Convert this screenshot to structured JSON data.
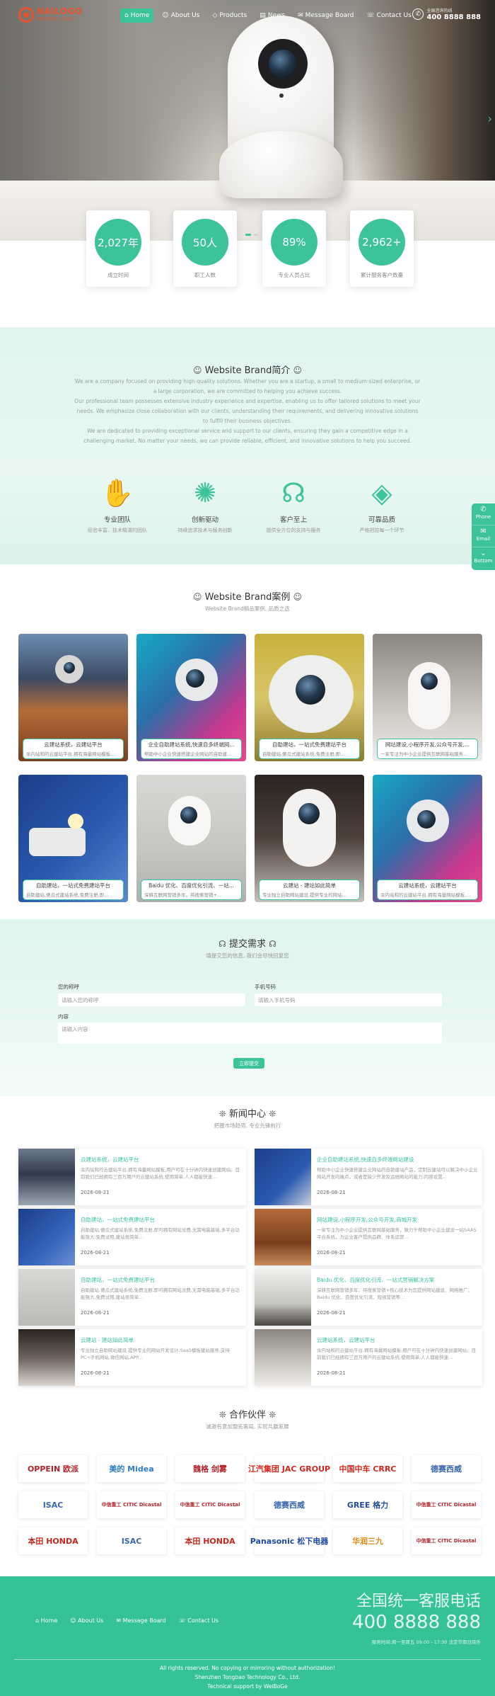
{
  "brand": {
    "name": "NAILOGO",
    "tagline": "WEBSITE LOGO",
    "color": "#e8532f"
  },
  "accent_color": "#3cc39a",
  "nav": [
    {
      "label": "Home",
      "icon": "home-icon",
      "active": true
    },
    {
      "label": "About Us",
      "icon": "user-icon"
    },
    {
      "label": "Products",
      "icon": "diamond-icon"
    },
    {
      "label": "News",
      "icon": "news-icon"
    },
    {
      "label": "Message Board",
      "icon": "chat-icon"
    },
    {
      "label": "Contact Us",
      "icon": "headset-icon"
    }
  ],
  "hotline": {
    "label": "全国咨询热线",
    "number": "400 8888 888"
  },
  "stats": [
    {
      "value": "2,027年",
      "caption": "成立时间"
    },
    {
      "value": "50人",
      "caption": "职工人数"
    },
    {
      "value": "89%",
      "caption": "专业人员占比"
    },
    {
      "value": "2,962+",
      "caption": "累计服务客户数量"
    }
  ],
  "about": {
    "title": "Website Brand简介",
    "paragraphs": [
      "We are a company focused on providing high-quality solutions. Whether you are a startup, a small to medium-sized enterprise, or a large corporation, we are committed to helping you achieve success.",
      "Our professional team possesses extensive industry experience and expertise, enabling us to offer tailored solutions to meet your needs. We emphasize close collaboration with our clients, understanding their requirements, and delivering innovative solutions to fulfill their business objectives.",
      "We are dedicated to providing exceptional service and support to our clients, ensuring they gain a competitive edge in a challenging market. No matter your needs, we can provide reliable, efficient, and innovative solutions to help you succeed."
    ],
    "features": [
      {
        "title": "专业团队",
        "desc": "经验丰富、技术精湛的团队",
        "icon": "handshake-icon"
      },
      {
        "title": "创新驱动",
        "desc": "持续追求技术与服务创新",
        "icon": "lightbulb-icon"
      },
      {
        "title": "客户至上",
        "desc": "提供全方位的支持与服务",
        "icon": "headset-icon"
      },
      {
        "title": "可靠品质",
        "desc": "严格把控每一个环节",
        "icon": "diamond-icon"
      }
    ]
  },
  "float_bar": [
    {
      "label": "Phone",
      "icon": "phone-icon"
    },
    {
      "label": "Email",
      "icon": "mail-icon"
    },
    {
      "label": "Bottom",
      "icon": "chevron-down-icon"
    }
  ],
  "cases": {
    "title": "Website Brand案例",
    "subtitle": "Website Brand精品案例, 品质之选",
    "items": [
      {
        "title": "云建站系统，云建站平台",
        "desc": "余内站和的云建站平台,拥有海量网站模板,..."
      },
      {
        "title": "企业自助建站系统,快速自多终端网...",
        "desc": "帮助中小企业快速搭建企业网站的自助建..."
      },
      {
        "title": "自助建站，一站式免费建站平台",
        "desc": "自助建站,傻瓜式建站系统,免费注册,即..."
      },
      {
        "title": "网站建设,小程序开发,公众号开发,...",
        "desc": "一家专注为中小企业提供互联网基础服务..."
      },
      {
        "title": "自助建站，一站式免费建站平台",
        "desc": "自助建站,傻瓜式建站系统,免费注册,即..."
      },
      {
        "title": "Baidu 优化、百度优化引流、一站...",
        "desc": "深耕互联网营销多年，将搜索营销+..."
      },
      {
        "title": "云建站 - 建站如此简单",
        "desc": "专业独立自助网站建设,提供专业的网站..."
      },
      {
        "title": "云建站系统，云建站平台",
        "desc": "余内站和的云建站平台,拥有海量网站模板,..."
      }
    ]
  },
  "form": {
    "title": "提交需求",
    "subtitle": "填提交您的信息, 我们会尽快回复您",
    "name_label": "您的称呼",
    "name_placeholder": "请输入您的称呼",
    "phone_label": "手机号码",
    "phone_placeholder": "请输入手机号码",
    "content_label": "内容",
    "content_placeholder": "请输入内容",
    "submit_label": "立即提交"
  },
  "news": {
    "title": "新闻中心",
    "subtitle": "把握市场趋势, 专业先锋前行",
    "items": [
      {
        "title": "云建站系统，云建站平台",
        "desc": "余内站和的云建站平台,拥有海量网站模板,用户可在十分钟内快速创建网站。目前我们已经拥有三百万用户的云建站系统,使用简单,人人都能快速...",
        "date": "2026-08-21"
      },
      {
        "title": "企业自助建站系统,快速自多终端网站建设",
        "desc": "帮助中小企业快速搭建企业网站的自助建站产品，定制云建站可以解决中小企业网站开发的痛点，或者是缺少开发及运维网站的能力,内容设置...",
        "date": "2026-08-21"
      },
      {
        "title": "自助建站，一站式免费建站平台",
        "desc": "自助建站,傻瓜式建站系统,免费注册,即可拥有网站没费,无需电脑基础,多平台功能强大,免费试用,建站很简单...",
        "date": "2026-08-21"
      },
      {
        "title": "网站建设,小程序开发,公众号开发,商城开发",
        "desc": "一家专注为中小企业提供互联网基础服务，致力于帮助中小企业建设一站SAAS平台系统，为企业客户提供品牌、体系运营...",
        "date": "2026-08-21"
      },
      {
        "title": "自助建站，一站式免费建站平台",
        "desc": "自助建站,傻瓜式建站系统,免费注册,即可拥有网站没费,无需电脑基础,多平台功能强大,免费试用,建站很简单...",
        "date": "2026-08-21"
      },
      {
        "title": "Baidu 优化、百度优化引流、一站式营销解决方案",
        "desc": "深耕互联网营销多年，将搜索营销+核心技术为您提供网站建设、网络推广、Baidu 优化、百度优化引流、短视营销等...",
        "date": "2026-08-21"
      },
      {
        "title": "云建站 - 建站如此简单",
        "desc": "专业独立自助网站建设,提供专业的网站开发设计,SaaS模板建站服务,支持PC+手机网站,微信网站,APP...",
        "date": "2026-08-21"
      },
      {
        "title": "云建站系统，云建站平台",
        "desc": "余内站和的云建站平台,拥有海量网站模板,用户可在十分钟内快速创建网站。目前我们已经拥有三百万用户的云建站系统,使用简单,人人都能快速...",
        "date": "2026-08-21"
      }
    ]
  },
  "partners": {
    "title": "合作伙伴",
    "subtitle": "诚邀有意加盟拓客局, 实现共赢发展",
    "items": [
      {
        "name": "OPPEIN 欧派",
        "color": "#b4232a"
      },
      {
        "name": "美的 Midea",
        "color": "#2f7dc4"
      },
      {
        "name": "魏格 剑雾",
        "color": "#b4232a"
      },
      {
        "name": "江汽集团 JAC GROUP",
        "color": "#d0271d"
      },
      {
        "name": "中国中车 CRRC",
        "color": "#d0271d"
      },
      {
        "name": "德赛西威",
        "color": "#3a66b0"
      },
      {
        "name": "ISAC",
        "color": "#3a66b0"
      },
      {
        "name": "中信重工 CITIC Dicastal",
        "color": "#b4232a"
      },
      {
        "name": "中信重工 CITIC Dicastal",
        "color": "#b4232a"
      },
      {
        "name": "德赛西威",
        "color": "#3a66b0"
      },
      {
        "name": "GREE 格力",
        "color": "#1f4ea3"
      },
      {
        "name": "中信重工 CITIC Dicastal",
        "color": "#b4232a"
      },
      {
        "name": "本田 HONDA",
        "color": "#c8261c"
      },
      {
        "name": "ISAC",
        "color": "#3a66b0"
      },
      {
        "name": "本田 HONDA",
        "color": "#c8261c"
      },
      {
        "name": "Panasonic 松下电器",
        "color": "#1b4aa0"
      },
      {
        "name": "华润三九",
        "color": "#d98b1a"
      },
      {
        "name": "中信重工 CITIC Dicastal",
        "color": "#b4232a"
      }
    ]
  },
  "footer": {
    "nav": [
      {
        "label": "Home",
        "icon": "home-icon"
      },
      {
        "label": "About Us",
        "icon": "user-icon"
      },
      {
        "label": "Message Board",
        "icon": "chat-icon"
      },
      {
        "label": "Contact Us",
        "icon": "headset-icon"
      }
    ],
    "call_label": "全国统一客服电话",
    "call_number": "400 8888 888",
    "hours": "服务时间:周一至周五 09:00 - 17:30 法定节假日除外",
    "copyright": "All rights reserved. No copying or mirroring without authorization!",
    "company": "Shenzhen Tongbao Technology Co., Ltd.",
    "support": "Technical support by WeiBoGe"
  }
}
